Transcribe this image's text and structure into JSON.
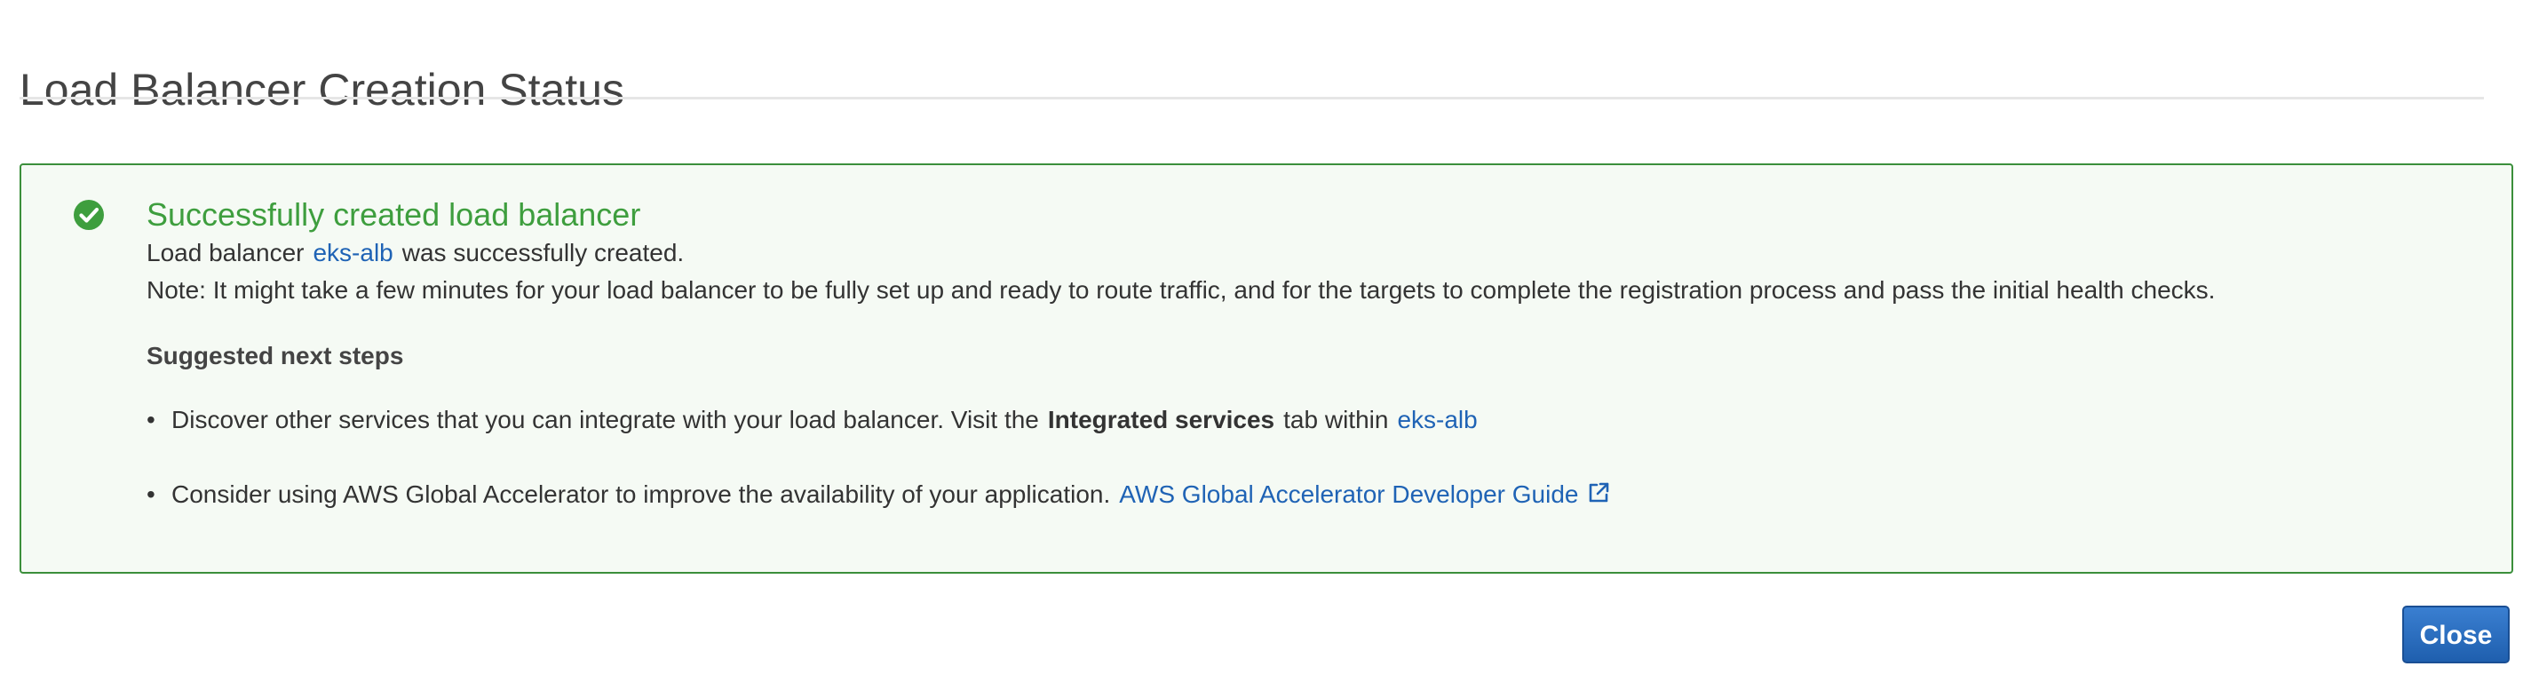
{
  "page": {
    "title": "Load Balancer Creation Status"
  },
  "alert": {
    "icon": "check-circle-icon",
    "title": "Successfully created load balancer",
    "line1_prefix": "Load balancer",
    "line1_link": "eks-alb",
    "line1_suffix": "was successfully created.",
    "note": "Note: It might take a few minutes for your load balancer to be fully set up and ready to route traffic, and for the targets to complete the registration process and pass the initial health checks.",
    "steps_heading": "Suggested next steps",
    "steps": [
      {
        "prefix": "Discover other services that you can integrate with your load balancer. Visit the",
        "bold": "Integrated services",
        "middle": "tab within",
        "link": "eks-alb"
      },
      {
        "prefix": "Consider using AWS Global Accelerator to improve the availability of your application.",
        "link": "AWS Global Accelerator Developer Guide",
        "link_icon": "external-link-icon"
      }
    ]
  },
  "footer": {
    "close_label": "Close"
  },
  "colors": {
    "success_green": "#3e9e3e",
    "alert_border": "#3b8f3b",
    "alert_background": "#f5faf4",
    "link_blue": "#1f63b5",
    "button_blue": "#2a6fc2"
  }
}
